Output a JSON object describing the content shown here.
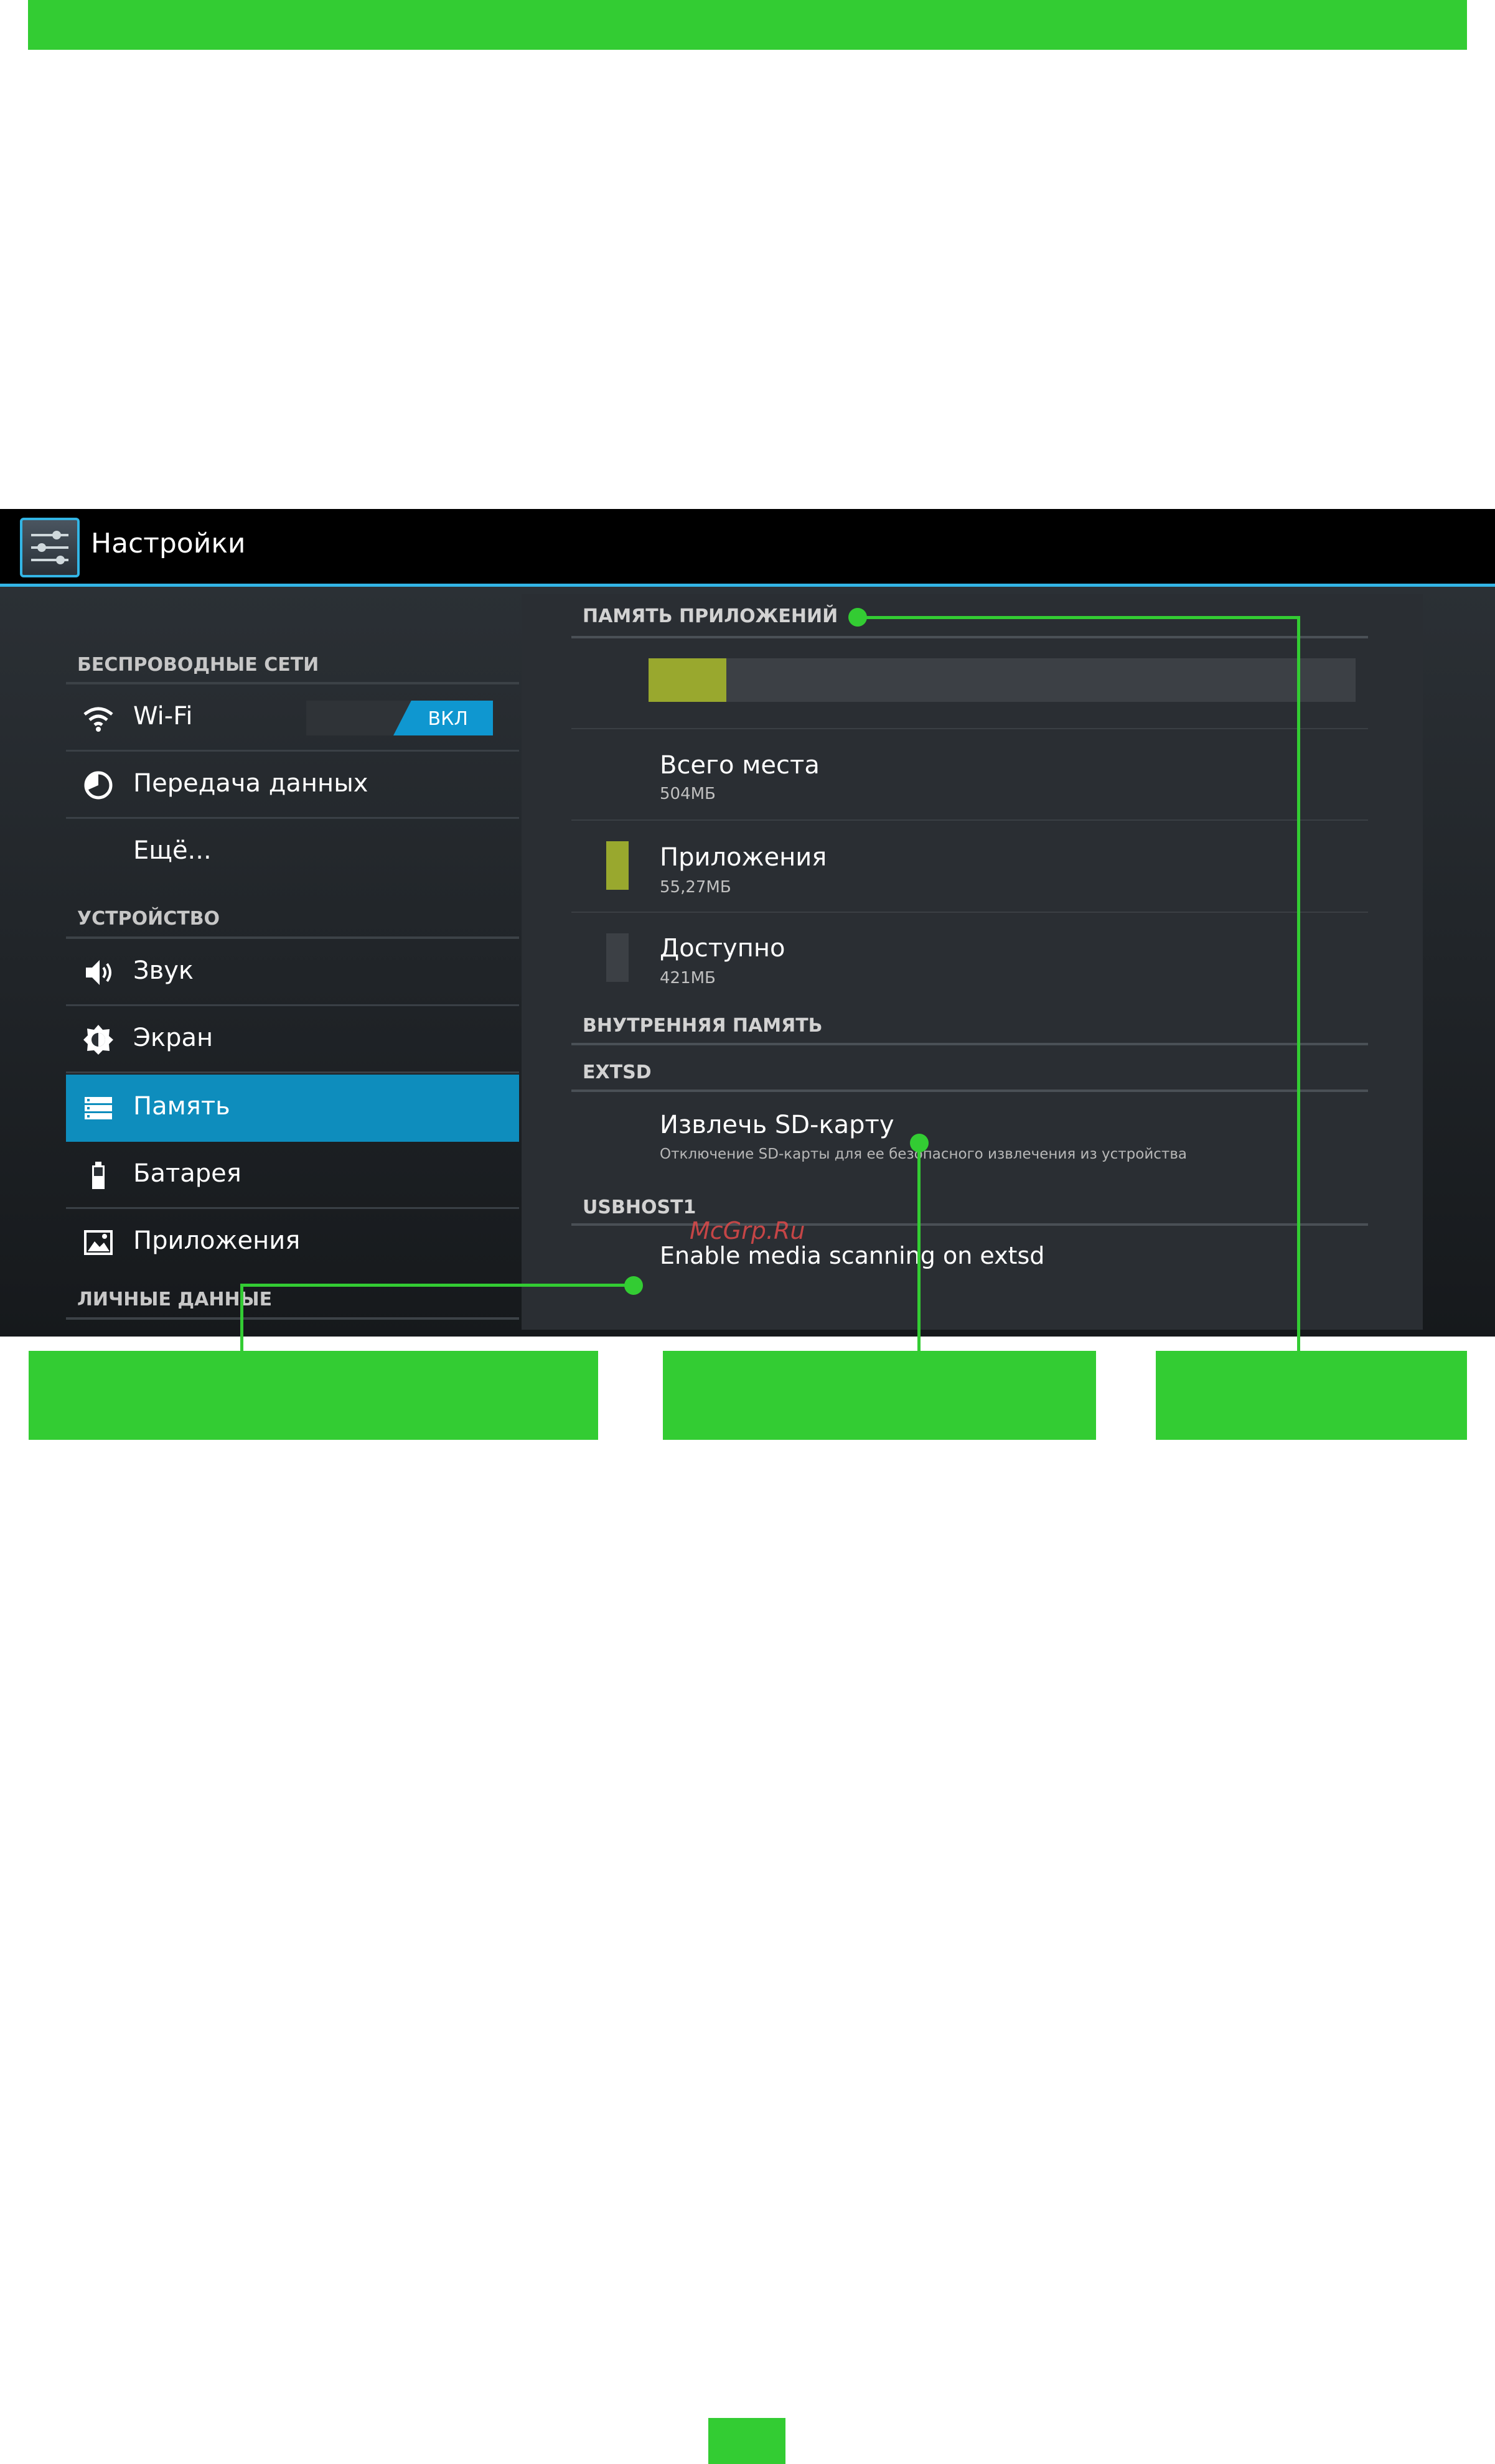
{
  "app_title": "Настройки",
  "sidebar": {
    "categories": {
      "wireless": "БЕСПРОВОДНЫЕ СЕТИ",
      "device": "УСТРОЙСТВО",
      "personal": "ЛИЧНЫЕ ДАННЫЕ"
    },
    "items": [
      {
        "label": "Wi-Fi",
        "icon": "wifi-icon"
      },
      {
        "label": "Передача данных",
        "icon": "data-usage-icon"
      },
      {
        "label": "Ещё...",
        "icon": ""
      },
      {
        "label": "Звук",
        "icon": "speaker-icon"
      },
      {
        "label": "Экран",
        "icon": "brightness-icon"
      },
      {
        "label": "Память",
        "icon": "storage-icon"
      },
      {
        "label": "Батарея",
        "icon": "battery-icon"
      },
      {
        "label": "Приложения",
        "icon": "apps-icon"
      }
    ],
    "wifi_toggle": "ВКЛ",
    "active_item": "Память"
  },
  "content": {
    "app_storage_header": "ПАМЯТЬ ПРИЛОЖЕНИЙ",
    "storage_used_fraction": 0.11,
    "total_title": "Всего места",
    "total_value": "504МБ",
    "apps_title": "Приложения",
    "apps_value": "55,27МБ",
    "available_title": "Доступно",
    "available_value": "421МБ",
    "internal_header": "ВНУТРЕННЯЯ ПАМЯТЬ",
    "extsd_header": "EXTSD",
    "eject_title": "Извлечь SD-карту",
    "eject_desc": "Отключение SD-карты для ее безопасного извлечения из устройства",
    "usbhost_header": "USBHOST1",
    "media_scan_title": "Enable media scanning on extsd"
  },
  "colors": {
    "accent": "#33b5e5",
    "callout_green": "#33cc33",
    "apps_swatch": "#99a82e",
    "available_swatch": "#3c4045"
  },
  "watermark": "McGrp.Ru"
}
